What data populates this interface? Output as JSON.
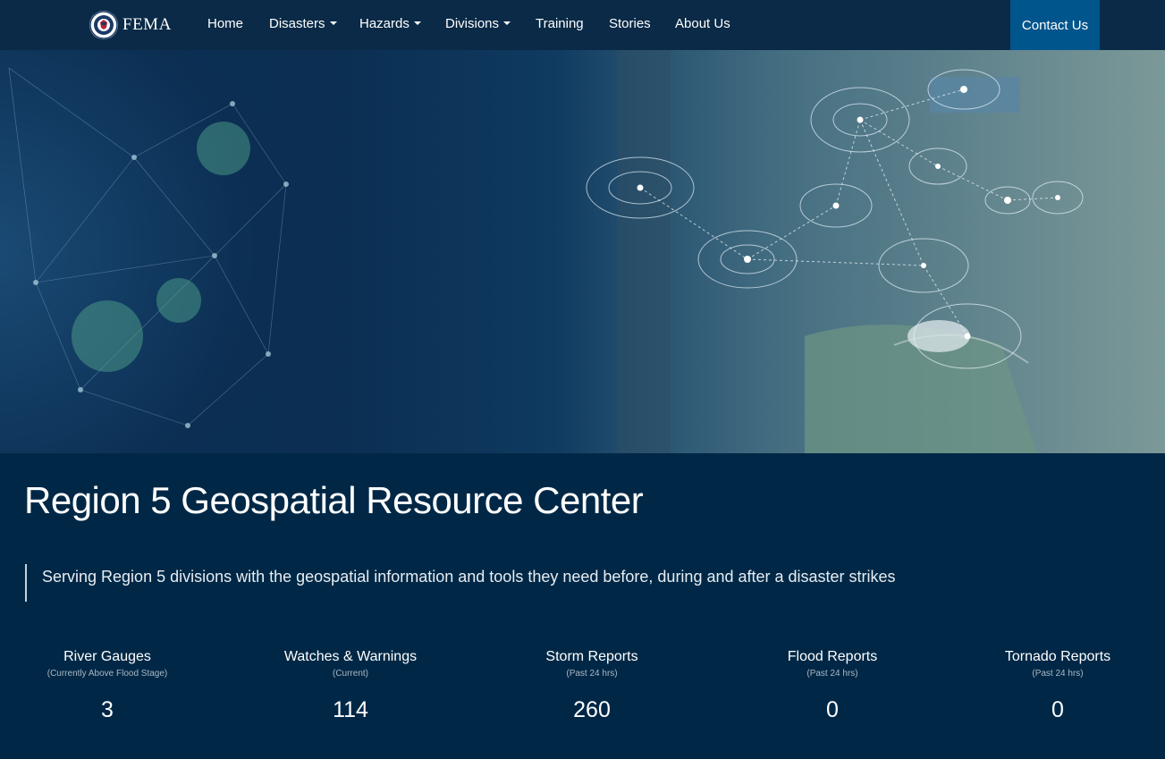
{
  "nav": {
    "logo_text": "FEMA",
    "items": [
      {
        "label": "Home",
        "dropdown": false
      },
      {
        "label": "Disasters",
        "dropdown": true
      },
      {
        "label": "Hazards",
        "dropdown": true
      },
      {
        "label": "Divisions",
        "dropdown": true
      },
      {
        "label": "Training",
        "dropdown": false
      },
      {
        "label": "Stories",
        "dropdown": false
      },
      {
        "label": "About Us",
        "dropdown": false
      }
    ],
    "contact_label": "Contact Us",
    "accent": "#00558c"
  },
  "page": {
    "title": "Region 5 Geospatial Resource Center",
    "tagline": "Serving Region 5 divisions with the geospatial information and tools they need before, during and after a disaster strikes"
  },
  "stats": [
    {
      "label": "River Gauges",
      "sub": "(Currently Above Flood Stage)",
      "value": "3"
    },
    {
      "label": "Watches & Warnings",
      "sub": "(Current)",
      "value": "114"
    },
    {
      "label": "Storm Reports",
      "sub": "(Past 24 hrs)",
      "value": "260"
    },
    {
      "label": "Flood Reports",
      "sub": "(Past 24 hrs)",
      "value": "0"
    },
    {
      "label": "Tornado Reports",
      "sub": "(Past 24 hrs)",
      "value": "0"
    }
  ],
  "colors": {
    "background": "#002846",
    "navbar": "#0a2a47"
  }
}
